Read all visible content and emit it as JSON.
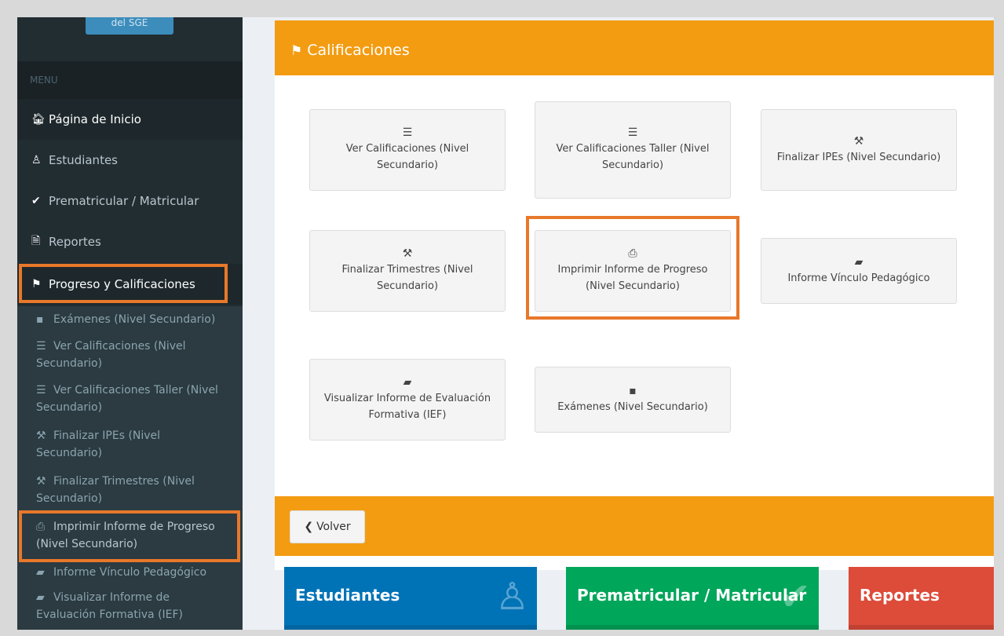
{
  "sidebar": {
    "login_button": "del SGE",
    "menu_header": "MENU",
    "items": [
      {
        "label": "Página de Inicio",
        "icon": "home-icon"
      },
      {
        "label": "Estudiantes",
        "icon": "male-icon"
      },
      {
        "label": "Prematricular / Matricular",
        "icon": "check-icon"
      },
      {
        "label": "Reportes",
        "icon": "file-icon"
      },
      {
        "label": "Progreso y Calificaciones",
        "icon": "flag-icon"
      }
    ],
    "subitems": [
      {
        "label": "Exámenes (Nivel Secundario)",
        "icon": "sticky-note-icon"
      },
      {
        "label": "Ver Calificaciones (Nivel Secundario)",
        "icon": "list-icon"
      },
      {
        "label": "Ver Calificaciones Taller (Nivel Secundario)",
        "icon": "list-icon"
      },
      {
        "label": "Finalizar IPEs (Nivel Secundario)",
        "icon": "gavel-icon"
      },
      {
        "label": "Finalizar Trimestres (Nivel Secundario)",
        "icon": "gavel-icon"
      },
      {
        "label": "Imprimir Informe de Progreso (Nivel Secundario)",
        "icon": "print-icon"
      },
      {
        "label": "Informe Vínculo Pedagógico",
        "icon": "book-icon"
      },
      {
        "label": "Visualizar Informe de Evaluación Formativa (IEF)",
        "icon": "book-icon"
      }
    ]
  },
  "panel": {
    "title": "Calificaciones",
    "tiles": [
      {
        "label": "Ver Calificaciones (Nivel Secundario)",
        "icon": "list-icon"
      },
      {
        "label": "Ver Calificaciones Taller (Nivel Secundario)",
        "icon": "list-icon"
      },
      {
        "label": "Finalizar IPEs (Nivel Secundario)",
        "icon": "gavel-icon"
      },
      {
        "label": "Finalizar Trimestres (Nivel Secundario)",
        "icon": "gavel-icon"
      },
      {
        "label": "Imprimir Informe de Progreso (Nivel Secundario)",
        "icon": "print-icon"
      },
      {
        "label": "Informe Vínculo Pedagógico",
        "icon": "book-icon"
      },
      {
        "label": "Visualizar Informe de Evaluación Formativa (IEF)",
        "icon": "book-icon"
      },
      {
        "label": "Exámenes (Nivel Secundario)",
        "icon": "sticky-note-icon"
      }
    ],
    "back_button": "Volver"
  },
  "infoboxes": [
    {
      "title": "Estudiantes",
      "color": "#0073b7"
    },
    {
      "title": "Prematricular / Matricular",
      "color": "#00a65a"
    },
    {
      "title": "Reportes",
      "color": "#dd4b39"
    }
  ],
  "colors": {
    "sidebar_bg": "#222d32",
    "panel_header": "#f39c12",
    "highlight": "#e8782a"
  }
}
